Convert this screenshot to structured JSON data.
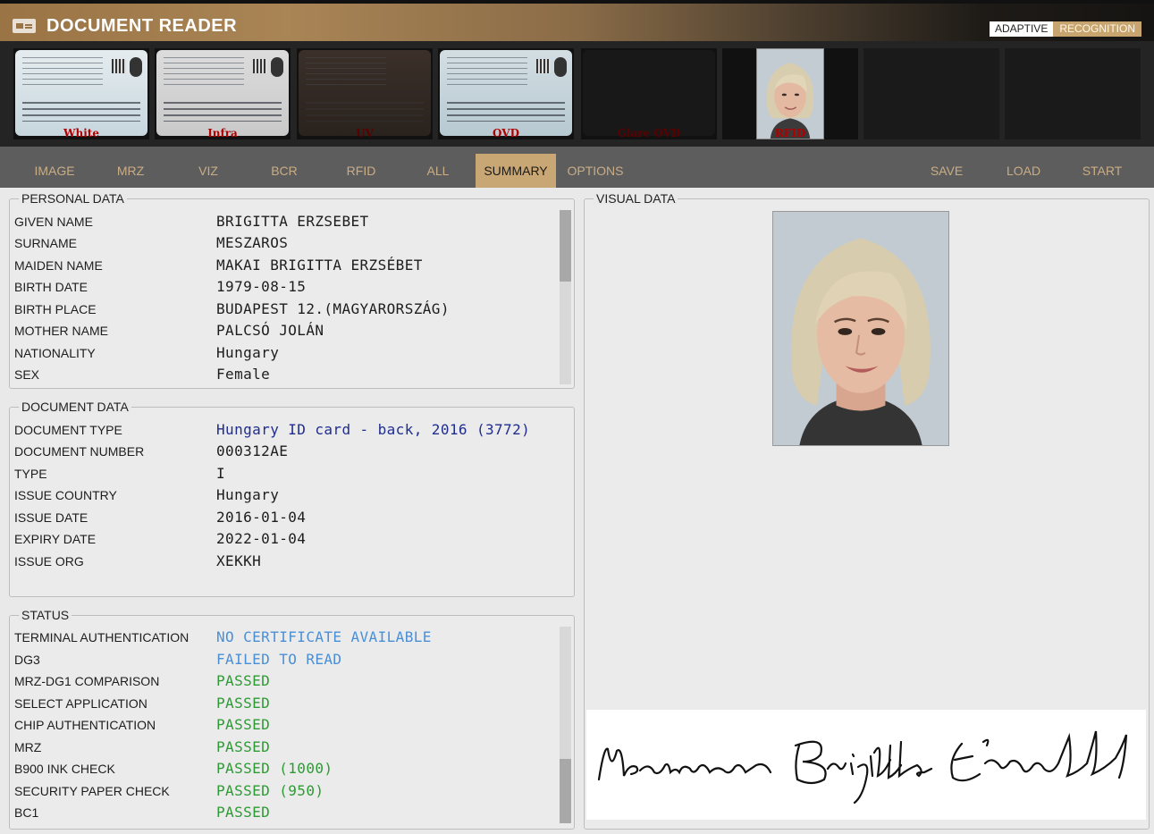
{
  "app": {
    "title": "DOCUMENT READER",
    "badge_left": "ADAPTIVE",
    "badge_right": "RECOGNITION"
  },
  "thumbnails": [
    {
      "label": "White",
      "kind": "card-white"
    },
    {
      "label": "Infra",
      "kind": "card-infra"
    },
    {
      "label": "UV",
      "kind": "card-uv"
    },
    {
      "label": "OVD",
      "kind": "card-ovd"
    },
    {
      "label": "Glare OVD",
      "kind": "dark"
    },
    {
      "label": "RFID",
      "kind": "face"
    },
    {
      "label": "",
      "kind": "empty"
    },
    {
      "label": "",
      "kind": "empty"
    }
  ],
  "tabs": [
    "IMAGE",
    "MRZ",
    "VIZ",
    "BCR",
    "RFID",
    "ALL",
    "SUMMARY",
    "OPTIONS"
  ],
  "active_tab": "SUMMARY",
  "actions": [
    "SAVE",
    "LOAD",
    "START"
  ],
  "personal": {
    "title": "PERSONAL DATA",
    "rows": [
      {
        "label": "GIVEN NAME",
        "value": "BRIGITTA ERZSEBET"
      },
      {
        "label": "SURNAME",
        "value": "MESZAROS"
      },
      {
        "label": "MAIDEN NAME",
        "value": "MAKAI BRIGITTA ERZSÉBET"
      },
      {
        "label": "BIRTH DATE",
        "value": "1979-08-15"
      },
      {
        "label": "BIRTH PLACE",
        "value": "BUDAPEST 12.(MAGYARORSZÁG)"
      },
      {
        "label": "MOTHER NAME",
        "value": "PALCSÓ JOLÁN"
      },
      {
        "label": "NATIONALITY",
        "value": "Hungary"
      },
      {
        "label": "SEX",
        "value": "Female"
      }
    ]
  },
  "document": {
    "title": "DOCUMENT DATA",
    "rows": [
      {
        "label": "DOCUMENT TYPE",
        "value": "Hungary ID card - back, 2016 (3772)"
      },
      {
        "label": "DOCUMENT NUMBER",
        "value": "000312AE"
      },
      {
        "label": "TYPE",
        "value": "I"
      },
      {
        "label": "ISSUE COUNTRY",
        "value": "Hungary"
      },
      {
        "label": "ISSUE DATE",
        "value": "2016-01-04"
      },
      {
        "label": "EXPIRY DATE",
        "value": "2022-01-04"
      },
      {
        "label": "ISSUE ORG",
        "value": "XEKKH"
      }
    ]
  },
  "status": {
    "title": "STATUS",
    "rows": [
      {
        "label": "TERMINAL AUTHENTICATION",
        "value": "NO CERTIFICATE AVAILABLE"
      },
      {
        "label": "DG3",
        "value": "FAILED TO READ"
      },
      {
        "label": "MRZ-DG1 COMPARISON",
        "value": "PASSED"
      },
      {
        "label": "SELECT APPLICATION",
        "value": "PASSED"
      },
      {
        "label": "CHIP AUTHENTICATION",
        "value": "PASSED"
      },
      {
        "label": "MRZ",
        "value": "PASSED"
      },
      {
        "label": "B900 INK CHECK",
        "value": "PASSED (1000)"
      },
      {
        "label": "SECURITY PAPER CHECK",
        "value": "PASSED (950)"
      },
      {
        "label": "BC1",
        "value": "PASSED"
      }
    ]
  },
  "visual": {
    "title": "VISUAL DATA",
    "signature_text": "Mészáros Brigitta Erzsébet"
  },
  "colors": {
    "accent_gold": "#c8a775",
    "tab_text": "#c9ad86",
    "doc_type_blue": "#1f2d8f",
    "warn_blue": "#4a8fd6",
    "pass_green": "#2d9b33",
    "thumb_label_red": "#b00000"
  },
  "icons": {
    "app": "id-card-icon"
  }
}
